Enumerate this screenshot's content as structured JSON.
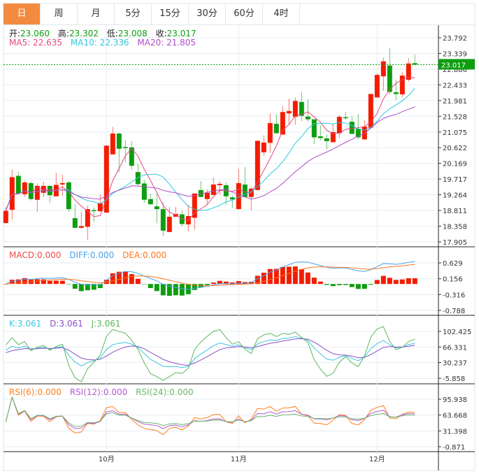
{
  "tabs": [
    {
      "label": "日",
      "active": true
    },
    {
      "label": "周"
    },
    {
      "label": "月"
    },
    {
      "label": "5分"
    },
    {
      "label": "15分"
    },
    {
      "label": "30分"
    },
    {
      "label": "60分"
    },
    {
      "label": "4时"
    }
  ],
  "ohlc_legend": {
    "open_label": "开:",
    "open": "23.060",
    "high_label": "高:",
    "high": "23.302",
    "low_label": "低:",
    "low": "23.008",
    "close_label": "收:",
    "close": "23.017"
  },
  "ma_legend": {
    "ma5": "MA5: 22.635",
    "ma10": "MA10: 22.336",
    "ma20": "MA20: 21.805"
  },
  "macd_legend": {
    "macd": "MACD:0.000",
    "diff": "DIFF:0.000",
    "dea": "DEA:0.000"
  },
  "kdj_legend": {
    "k": "K:3.061",
    "d": "D:3.061",
    "j": "J:3.061"
  },
  "rsi_legend": {
    "rsi6": "RSI(6):0.000",
    "rsi12": "RSI(12):0.000",
    "rsi24": "RSI(24):0.000"
  },
  "colors": {
    "up": "#f21c00",
    "down": "#0f9d0f",
    "ma5": "#e8467c",
    "ma10": "#2ec7e0",
    "ma20": "#b04fc9",
    "diff": "#4aa3f0",
    "dea": "#ff7722",
    "k": "#3cc6e0",
    "d": "#8a50c8",
    "j": "#5cb85c",
    "rsi6": "#ff7f1e",
    "rsi12": "#b45cd0",
    "rsi24": "#6ab86a",
    "tab_active": "#f28b3f"
  },
  "chart_data": [
    {
      "type": "candlestick",
      "grid": true,
      "yticks": [
        "23.792",
        "23.339",
        "22.886",
        "22.433",
        "21.981",
        "21.528",
        "21.075",
        "20.622",
        "20.169",
        "19.717",
        "19.264",
        "18.811",
        "18.358",
        "17.905"
      ],
      "ylim": [
        17.905,
        23.792
      ],
      "last_price": "23.017",
      "xticks": [
        {
          "index": 16,
          "label": "10月"
        },
        {
          "index": 37,
          "label": "11月"
        },
        {
          "index": 59,
          "label": "12月"
        }
      ],
      "ohlc": [
        [
          18.45,
          18.91,
          18.43,
          18.8
        ],
        [
          18.83,
          19.99,
          18.55,
          19.77
        ],
        [
          19.81,
          19.92,
          19.3,
          19.3
        ],
        [
          19.28,
          19.67,
          19.2,
          19.62
        ],
        [
          19.6,
          19.64,
          19.1,
          19.14
        ],
        [
          19.12,
          19.59,
          18.77,
          19.52
        ],
        [
          19.32,
          19.64,
          19.2,
          19.52
        ],
        [
          19.52,
          19.54,
          19.03,
          19.25
        ],
        [
          19.22,
          19.9,
          19.22,
          19.55
        ],
        [
          19.56,
          19.84,
          19.24,
          19.6
        ],
        [
          19.62,
          19.67,
          18.77,
          18.85
        ],
        [
          18.59,
          19.0,
          18.31,
          18.31
        ],
        [
          18.31,
          18.77,
          18.29,
          18.36
        ],
        [
          18.34,
          18.95,
          17.96,
          18.85
        ],
        [
          18.82,
          18.9,
          18.48,
          18.79
        ],
        [
          18.79,
          19.27,
          18.77,
          19.02
        ],
        [
          18.75,
          20.69,
          18.75,
          20.68
        ],
        [
          20.43,
          21.22,
          20.43,
          21.03
        ],
        [
          21.03,
          21.05,
          19.92,
          20.59
        ],
        [
          20.64,
          20.85,
          20.21,
          20.61
        ],
        [
          20.63,
          20.81,
          19.99,
          20.1
        ],
        [
          19.92,
          20.16,
          19.5,
          19.57
        ],
        [
          19.59,
          19.69,
          19.03,
          19.12
        ],
        [
          19.14,
          19.3,
          18.99,
          18.99
        ],
        [
          18.93,
          19.28,
          18.44,
          18.85
        ],
        [
          18.85,
          19.05,
          18.07,
          18.23
        ],
        [
          18.19,
          18.91,
          18.19,
          18.63
        ],
        [
          18.63,
          18.91,
          18.63,
          18.71
        ],
        [
          18.7,
          18.8,
          18.35,
          18.42
        ],
        [
          18.41,
          18.98,
          18.21,
          18.65
        ],
        [
          18.6,
          19.3,
          18.26,
          19.3
        ],
        [
          19.4,
          19.66,
          19.2,
          19.2
        ],
        [
          19.14,
          19.42,
          18.97,
          19.32
        ],
        [
          19.26,
          19.76,
          19.26,
          19.56
        ],
        [
          19.54,
          19.65,
          19.28,
          19.58
        ],
        [
          19.54,
          19.62,
          18.98,
          19.22
        ],
        [
          19.19,
          19.24,
          18.89,
          19.13
        ],
        [
          18.85,
          20.01,
          18.85,
          19.6
        ],
        [
          19.56,
          20.06,
          19.2,
          19.2
        ],
        [
          19.2,
          19.5,
          18.82,
          19.44
        ],
        [
          19.4,
          20.82,
          19.4,
          20.82
        ],
        [
          20.49,
          20.98,
          20.38,
          20.77
        ],
        [
          20.76,
          21.61,
          20.48,
          21.33
        ],
        [
          21.31,
          21.59,
          21.02,
          21.04
        ],
        [
          21.0,
          21.82,
          21.0,
          21.65
        ],
        [
          21.61,
          22.04,
          21.29,
          21.68
        ],
        [
          21.51,
          22.07,
          21.29,
          21.97
        ],
        [
          21.94,
          22.24,
          21.39,
          21.54
        ],
        [
          21.52,
          22.02,
          21.37,
          21.44
        ],
        [
          21.44,
          21.44,
          20.73,
          20.92
        ],
        [
          20.95,
          21.27,
          20.83,
          20.9
        ],
        [
          20.89,
          21.0,
          20.57,
          20.81
        ],
        [
          20.78,
          21.31,
          20.78,
          21.07
        ],
        [
          21.04,
          21.57,
          20.9,
          21.51
        ],
        [
          21.5,
          21.65,
          21.43,
          21.47
        ],
        [
          21.37,
          21.53,
          21.02,
          21.02
        ],
        [
          21.17,
          21.59,
          20.86,
          20.92
        ],
        [
          20.86,
          21.42,
          20.86,
          21.23
        ],
        [
          21.2,
          22.17,
          21.2,
          22.17
        ],
        [
          22.07,
          22.76,
          22.07,
          22.72
        ],
        [
          22.68,
          23.22,
          22.26,
          23.11
        ],
        [
          22.99,
          23.5,
          22.16,
          22.23
        ],
        [
          22.22,
          22.58,
          22.0,
          22.17
        ],
        [
          22.16,
          22.8,
          22.08,
          22.7
        ],
        [
          22.58,
          23.2,
          22.53,
          23.05
        ],
        [
          23.06,
          23.302,
          23.008,
          23.017
        ]
      ]
    },
    {
      "type": "bar+line",
      "name": "MACD",
      "yticks": [
        "0.629",
        "0.156",
        "-0.316",
        "-0.788"
      ],
      "ylim": [
        -0.788,
        0.629
      ]
    },
    {
      "type": "line",
      "name": "KDJ",
      "yticks": [
        "102.425",
        "66.331",
        "30.237",
        "-5.858"
      ],
      "ylim": [
        -5.858,
        102.425
      ]
    },
    {
      "type": "line",
      "name": "RSI",
      "yticks": [
        "95.938",
        "63.668",
        "31.398",
        "-0.871"
      ],
      "ylim": [
        -0.871,
        95.938
      ]
    }
  ]
}
